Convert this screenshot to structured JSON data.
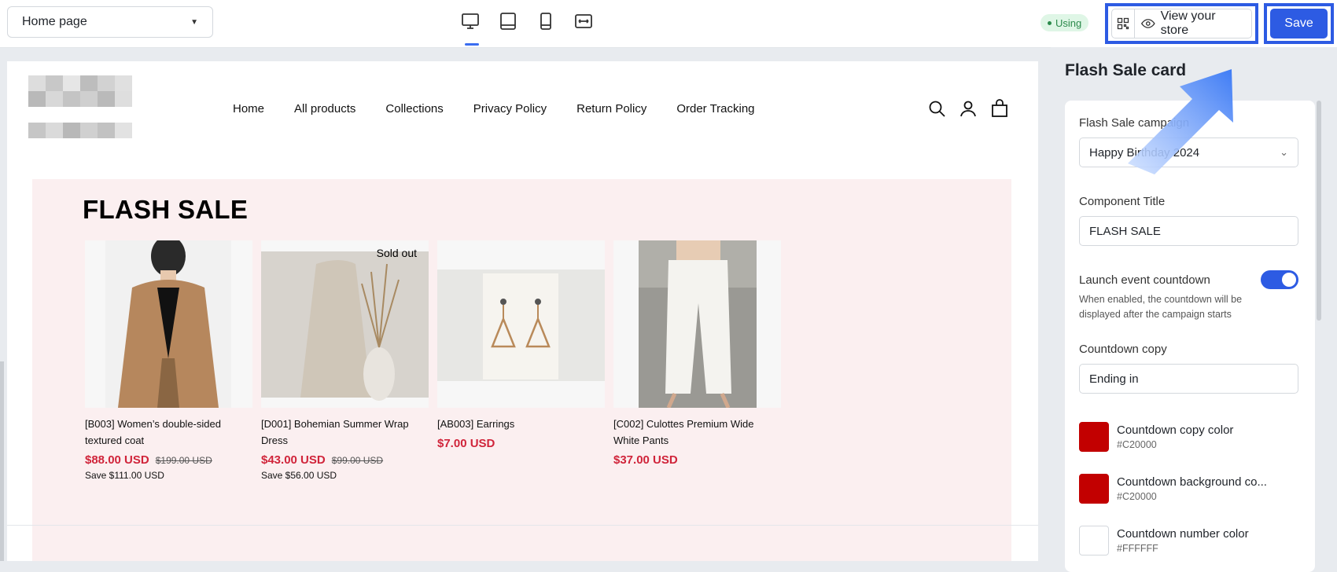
{
  "topbar": {
    "page_select": "Home page",
    "devices": [
      "desktop",
      "tablet-landscape",
      "tablet-portrait",
      "fullscreen"
    ],
    "status_badge": "Using",
    "view_store": "View your store",
    "save": "Save"
  },
  "store": {
    "nav": [
      "Home",
      "All products",
      "Collections",
      "Privacy Policy",
      "Return Policy",
      "Order Tracking"
    ],
    "header_icons": [
      "search-icon",
      "account-icon",
      "cart-icon"
    ],
    "flash_title": "FLASH SALE",
    "products": [
      {
        "name": "[B003] Women’s double-sided textured coat",
        "price": "$88.00 USD",
        "compare": "$199.00 USD",
        "save": "Save $111.00 USD",
        "badge": ""
      },
      {
        "name": "[D001] Bohemian Summer Wrap Dress",
        "price": "$43.00 USD",
        "compare": "$99.00 USD",
        "save": "Save $56.00 USD",
        "badge": "Sold out"
      },
      {
        "name": "[AB003] Earrings",
        "price": "$7.00 USD",
        "compare": "",
        "save": "",
        "badge": ""
      },
      {
        "name": "[C002] Culottes Premium Wide White Pants",
        "price": "$37.00 USD",
        "compare": "",
        "save": "",
        "badge": ""
      }
    ]
  },
  "settings": {
    "title": "Flash Sale card",
    "campaign_label": "Flash Sale campaign",
    "campaign_value": "Happy Birthday 2024",
    "component_title_label": "Component Title",
    "component_title_value": "FLASH SALE",
    "countdown_toggle_label": "Launch event countdown",
    "countdown_toggle_on": true,
    "countdown_hint": "When enabled, the countdown will be displayed after the campaign starts",
    "countdown_copy_label": "Countdown copy",
    "countdown_copy_value": "Ending in",
    "colors": [
      {
        "name": "Countdown copy color",
        "hex": "#C20000"
      },
      {
        "name": "Countdown background co...",
        "hex": "#C20000"
      },
      {
        "name": "Countdown number color",
        "hex": "#FFFFFF"
      }
    ]
  },
  "colors": {
    "accent": "#2d5be3",
    "sale_price": "#d0243a",
    "panel_bg": "#fbeff0"
  }
}
